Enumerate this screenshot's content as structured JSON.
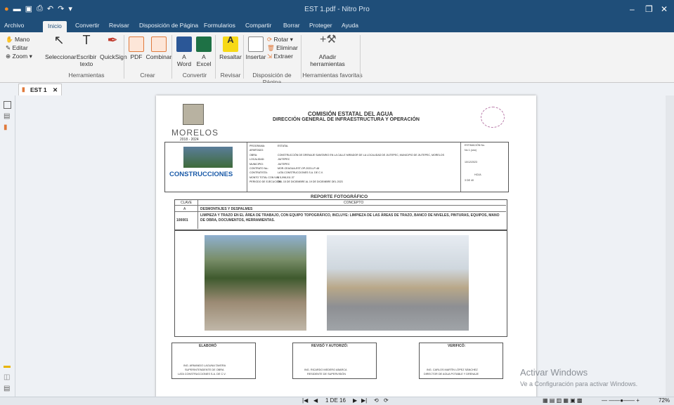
{
  "window": {
    "title": "EST 1.pdf - Nitro Pro"
  },
  "menu": {
    "tabs": [
      "Archivo",
      "Inicio",
      "Convertir",
      "Revisar",
      "Disposición de Página",
      "Formularios",
      "Compartir",
      "Borrar",
      "Proteger",
      "Ayuda"
    ],
    "active": "Inicio"
  },
  "ribbon": {
    "mano": "Mano",
    "editar": "Editar",
    "zoom": "Zoom",
    "seleccionar": "Seleccionar",
    "escribir": "Escribir texto",
    "quicksign": "QuickSign",
    "herramientas_group": "Herramientas",
    "pdf": "PDF",
    "combinar": "Combinar",
    "crear_group": "Crear",
    "a_word": "A Word",
    "a_excel": "A Excel",
    "convertir_group": "Convertir",
    "resaltar": "Resaltar",
    "revisar_group": "Revisar",
    "insertar": "Insertar",
    "rotar": "Rotar",
    "eliminar": "Eliminar",
    "extraer": "Extraer",
    "disposicion_group": "Disposición de Página",
    "anadir": "Añadir herramientas",
    "favoritas_group": "Herramientas favoritas"
  },
  "doc_tab": {
    "label": "EST 1"
  },
  "pdf": {
    "morelos": "MORELOS",
    "period": "2018 - 2024",
    "header1": "COMISIÓN ESTATAL DEL AGUA",
    "header2": "DIRECCIÓN GENERAL DE INFRAESTRUCTURA Y OPERACIÓN",
    "company": "CONSTRUCCIONES",
    "reporte": "REPORTE FOTOGRÁFICO",
    "col_clave": "CLAVE",
    "col_concepto": "CONCEPTO",
    "row1_clave": "A",
    "row1_concepto": "DESMONTAJES Y DESPALMES",
    "row2_clave": "100001",
    "row2_concepto": "LIMPIEZA Y TRAZO EN EL ÁREA DE TRABAJO, CON EQUIPO TOPOGRÁFICO, INCLUYE: LIMPIEZA DE LAS ÁREAS DE TRAZO, BANCO DE NIVELES, PINTURAS, EQUIPOS, MANO DE OBRA, DOCUMENTOS, HERRAMIENTAS.",
    "sig1_title": "ELABORÓ",
    "sig1_name": "ING. ARMANDO LAGUNA TAVERA",
    "sig1_role": "SUPERINTENDENTE DE OBRA",
    "sig1_org": "LATA CONSTRUCCIONES S.A. DE C.V.",
    "sig2_title": "REVISÓ Y AUTORIZÓ:",
    "sig2_name": "ING. RICARDO MEDERO ABARCA",
    "sig2_role": "RESIDENTE DE SUPERVISIÓN",
    "sig3_title": "VERIFICÓ:",
    "sig3_name": "ING. CARLOS MARTÍN LÓPEZ SÁNCHEZ",
    "sig3_role": "DIRECTOR DE AGUA POTABLE Y DRENAJE",
    "estimacion": "ESTIMACIÓN No.",
    "estimacion_val": "No 1 (uno)",
    "fecha_val": "10/12/2023",
    "hoja": "HOJA",
    "hoja_val": "3 DE 40",
    "info_labels": [
      "PROGRAMA:",
      "APARTADO:",
      "OBRA:",
      "LOCALIDAD:",
      "MUNICIPIO:",
      "CONTRATO No.:",
      "CONTRATISTA:",
      "MONTO TOTAL CON IVA:",
      "PERIODO DE EJECUCIÓN:"
    ],
    "info_values": [
      "ESTATAL",
      "",
      "CONSTRUCCIÓN DE DRENAJE SANITARIO EN LA CALLE MIRADOR DE LA LOCALIDAD DE JIUTEPEC, MUNICIPIO DE JIUTEPEC, MORELOS",
      "JIUTEPEC",
      "JIUTEPEC",
      "MOR-CEAGUA-EST-OP-2023-LP-48",
      "LATA CONSTRUCCIONES S.A. DE C.V.",
      "$ 5,098,011.37",
      "DEL 15 DE DICIEMBRE AL 19 DE DICIEMBRE DEL 2023"
    ]
  },
  "activate": {
    "line1": "Activar Windows",
    "line2": "Ve a Configuración para activar Windows."
  },
  "status": {
    "page": "1 DE 16",
    "zoom": "72%"
  }
}
